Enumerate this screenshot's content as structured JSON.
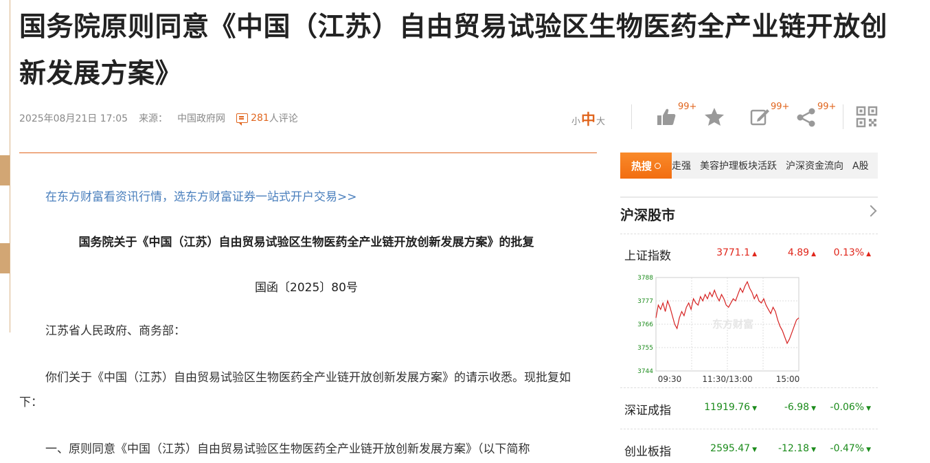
{
  "article": {
    "title": "国务院原则同意《中国（江苏）自由贸易试验区生物医药全产业链开放创新发展方案》",
    "date": "2025年08月21日 17:05",
    "source_label": "来源：",
    "source": "中国政府网",
    "comment_count": "281",
    "comment_unit": "人评论",
    "font_small": "小",
    "font_medium": "中",
    "font_large": "大",
    "promo_link": "在东方财富看资讯行情，选东方财富证券一站式开户交易>>",
    "reply_title": "国务院关于《中国（江苏）自由贸易试验区生物医药全产业链开放创新发展方案》的批复",
    "doc_no": "国函〔2025〕80号",
    "addressee": "江苏省人民政府、商务部：",
    "para1": "你们关于《中国（江苏）自由贸易试验区生物医药全产业链开放创新发展方案》的请示收悉。现批复如下：",
    "para2": "一、原则同意《中国（江苏）自由贸易试验区生物医药全产业链开放创新发展方案》（以下简称"
  },
  "toolbar": {
    "like_count": "99+",
    "edit_count": "99+",
    "share_count": "99+",
    "like_icon": "thumbs-up-icon",
    "favorite_icon": "star-icon",
    "edit_icon": "edit-icon",
    "share_icon": "share-icon",
    "qr_icon": "qr-code-icon"
  },
  "hot_search": {
    "label": "热搜",
    "items": [
      "走强",
      "美容护理板块活跃",
      "沪深资金流向",
      "A股"
    ]
  },
  "market": {
    "title": "沪深股市",
    "indices": [
      {
        "name": "上证指数",
        "value": "3771.1",
        "change": "4.89",
        "pct": "0.13%",
        "direction": "up"
      },
      {
        "name": "深证成指",
        "value": "11919.76",
        "change": "-6.98",
        "pct": "-0.06%",
        "direction": "down"
      },
      {
        "name": "创业板指",
        "value": "2595.47",
        "change": "-12.18",
        "pct": "-0.47%",
        "direction": "down"
      }
    ],
    "colors": {
      "up": "#e0251a",
      "down": "#1b8b1b",
      "accent": "#e0641c"
    }
  },
  "chart_data": {
    "type": "line",
    "title": "",
    "watermark": "东方财富",
    "x_ticks": [
      "09:30",
      "11:30/13:00",
      "15:00"
    ],
    "y_ticks": [
      "3788",
      "3777",
      "3766",
      "3755",
      "3744"
    ],
    "ylim": [
      3744,
      3788
    ],
    "grid": true,
    "series": [
      {
        "values": [
          3769,
          3775,
          3773,
          3776,
          3772,
          3777,
          3774,
          3770,
          3766,
          3764,
          3769,
          3772,
          3770,
          3774,
          3776,
          3773,
          3778,
          3776,
          3775,
          3779,
          3777,
          3780,
          3778,
          3781,
          3779,
          3782,
          3779,
          3777,
          3780,
          3778,
          3775,
          3774,
          3776,
          3778,
          3777,
          3780,
          3783,
          3781,
          3784,
          3786,
          3783,
          3781,
          3778,
          3780,
          3777,
          3776,
          3778,
          3775,
          3773,
          3771,
          3774,
          3772,
          3768,
          3765,
          3763,
          3760,
          3757,
          3759,
          3762,
          3765,
          3768,
          3769
        ]
      }
    ]
  }
}
